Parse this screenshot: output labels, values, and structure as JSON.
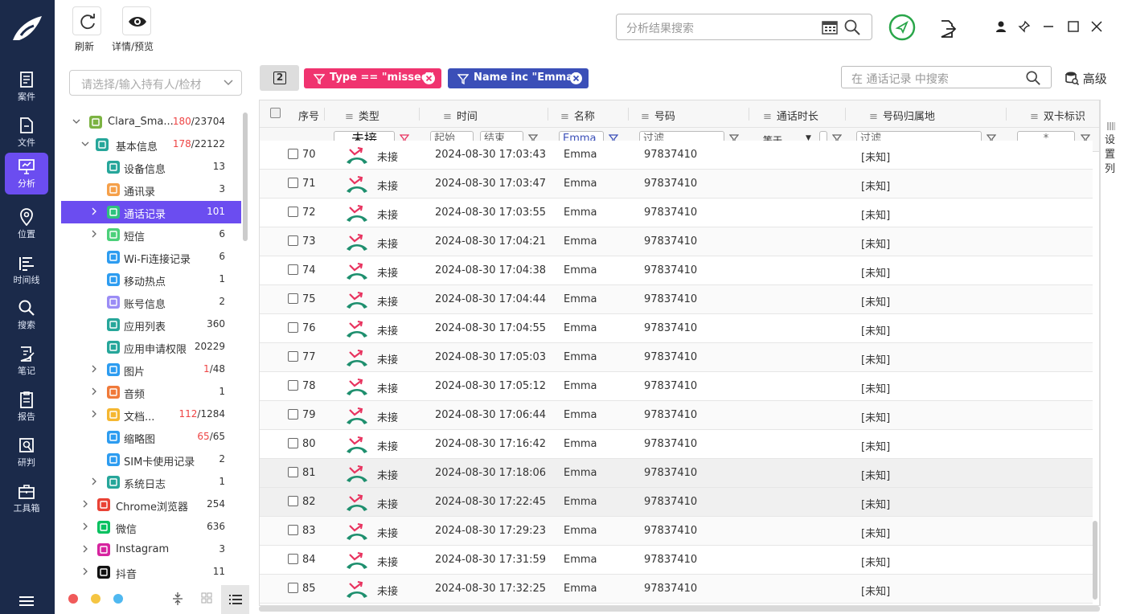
{
  "nav": {
    "items": [
      {
        "label": "案件",
        "icon": "case-icon"
      },
      {
        "label": "文件",
        "icon": "file-icon"
      },
      {
        "label": "分析",
        "icon": "analysis-icon"
      },
      {
        "label": "位置",
        "icon": "location-icon"
      },
      {
        "label": "时间线",
        "icon": "timeline-icon"
      },
      {
        "label": "搜索",
        "icon": "search-icon"
      },
      {
        "label": "笔记",
        "icon": "notes-icon"
      },
      {
        "label": "报告",
        "icon": "report-icon"
      },
      {
        "label": "研判",
        "icon": "judge-icon"
      },
      {
        "label": "工具箱",
        "icon": "toolbox-icon"
      }
    ],
    "active_index": 2
  },
  "toolbar": {
    "refresh_label": "刷新",
    "detail_label": "详情/预览",
    "search_placeholder": "分析结果搜索"
  },
  "tree": {
    "select_placeholder": "请选择/输入持有人/检材",
    "rows": [
      {
        "label": "Clara_Sma...",
        "count_red": "180",
        "count": "/23704"
      },
      {
        "label": "基本信息",
        "count_red": "178",
        "count": "/22122"
      },
      {
        "label": "设备信息",
        "count_red": "",
        "count": "13"
      },
      {
        "label": "通讯录",
        "count_red": "",
        "count": "3"
      },
      {
        "label": "通话记录",
        "count_red": "",
        "count": "101"
      },
      {
        "label": "短信",
        "count_red": "",
        "count": "6"
      },
      {
        "label": "Wi-Fi连接记录",
        "count_red": "",
        "count": "6"
      },
      {
        "label": "移动热点",
        "count_red": "",
        "count": "1"
      },
      {
        "label": "账号信息",
        "count_red": "",
        "count": "2"
      },
      {
        "label": "应用列表",
        "count_red": "",
        "count": "360"
      },
      {
        "label": "应用申请权限",
        "count_red": "",
        "count": "20229"
      },
      {
        "label": "图片",
        "count_red": "1",
        "count": "/48"
      },
      {
        "label": "音频",
        "count_red": "",
        "count": "1"
      },
      {
        "label": "文档...",
        "count_red": "112",
        "count": "/1284"
      },
      {
        "label": "缩略图",
        "count_red": "65",
        "count": "/65"
      },
      {
        "label": "SIM卡使用记录",
        "count_red": "",
        "count": "2"
      },
      {
        "label": "系统日志",
        "count_red": "",
        "count": "1"
      },
      {
        "label": "Chrome浏览器",
        "count_red": "",
        "count": "254"
      },
      {
        "label": "微信",
        "count_red": "",
        "count": "636"
      },
      {
        "label": "Instagram",
        "count_red": "",
        "count": "3"
      },
      {
        "label": "抖音",
        "count_red": "",
        "count": "11"
      }
    ]
  },
  "filters": {
    "toggle_label": "2",
    "chip1": "Type == \"missed\"",
    "chip2": "Name inc \"Emma\"",
    "table_search_placeholder": "在 通话记录 中搜索",
    "advanced_label": "高级",
    "chip1_color": "#f0336f",
    "chip2_color": "#3b4fb8"
  },
  "grid": {
    "headers": [
      "序号",
      "类型",
      "时间",
      "名称",
      "号码",
      "通话时长",
      "号码归属地",
      "双卡标识"
    ],
    "filter": {
      "type_value": "未接",
      "start": "起始",
      "end": "结束",
      "name_value": "Emma",
      "number": "过滤",
      "duration_op": "等于",
      "location": "过滤",
      "dual": "*"
    },
    "rows": [
      {
        "no": "70",
        "type": "未接",
        "time": "2024-08-30 17:03:43",
        "name": "Emma",
        "number": "97837410",
        "loc": "[未知]"
      },
      {
        "no": "71",
        "type": "未接",
        "time": "2024-08-30 17:03:47",
        "name": "Emma",
        "number": "97837410",
        "loc": "[未知]"
      },
      {
        "no": "72",
        "type": "未接",
        "time": "2024-08-30 17:03:55",
        "name": "Emma",
        "number": "97837410",
        "loc": "[未知]"
      },
      {
        "no": "73",
        "type": "未接",
        "time": "2024-08-30 17:04:21",
        "name": "Emma",
        "number": "97837410",
        "loc": "[未知]"
      },
      {
        "no": "74",
        "type": "未接",
        "time": "2024-08-30 17:04:38",
        "name": "Emma",
        "number": "97837410",
        "loc": "[未知]"
      },
      {
        "no": "75",
        "type": "未接",
        "time": "2024-08-30 17:04:44",
        "name": "Emma",
        "number": "97837410",
        "loc": "[未知]"
      },
      {
        "no": "76",
        "type": "未接",
        "time": "2024-08-30 17:04:55",
        "name": "Emma",
        "number": "97837410",
        "loc": "[未知]"
      },
      {
        "no": "77",
        "type": "未接",
        "time": "2024-08-30 17:05:03",
        "name": "Emma",
        "number": "97837410",
        "loc": "[未知]"
      },
      {
        "no": "78",
        "type": "未接",
        "time": "2024-08-30 17:05:12",
        "name": "Emma",
        "number": "97837410",
        "loc": "[未知]"
      },
      {
        "no": "79",
        "type": "未接",
        "time": "2024-08-30 17:06:44",
        "name": "Emma",
        "number": "97837410",
        "loc": "[未知]"
      },
      {
        "no": "80",
        "type": "未接",
        "time": "2024-08-30 17:16:42",
        "name": "Emma",
        "number": "97837410",
        "loc": "[未知]"
      },
      {
        "no": "81",
        "type": "未接",
        "time": "2024-08-30 17:18:06",
        "name": "Emma",
        "number": "97837410",
        "loc": "[未知]"
      },
      {
        "no": "82",
        "type": "未接",
        "time": "2024-08-30 17:22:45",
        "name": "Emma",
        "number": "97837410",
        "loc": "[未知]"
      },
      {
        "no": "83",
        "type": "未接",
        "time": "2024-08-30 17:29:23",
        "name": "Emma",
        "number": "97837410",
        "loc": "[未知]"
      },
      {
        "no": "84",
        "type": "未接",
        "time": "2024-08-30 17:31:59",
        "name": "Emma",
        "number": "97837410",
        "loc": "[未知]"
      },
      {
        "no": "85",
        "type": "未接",
        "time": "2024-08-30 17:32:25",
        "name": "Emma",
        "number": "97837410",
        "loc": "[未知]"
      }
    ]
  },
  "set_columns_label": "设置列"
}
